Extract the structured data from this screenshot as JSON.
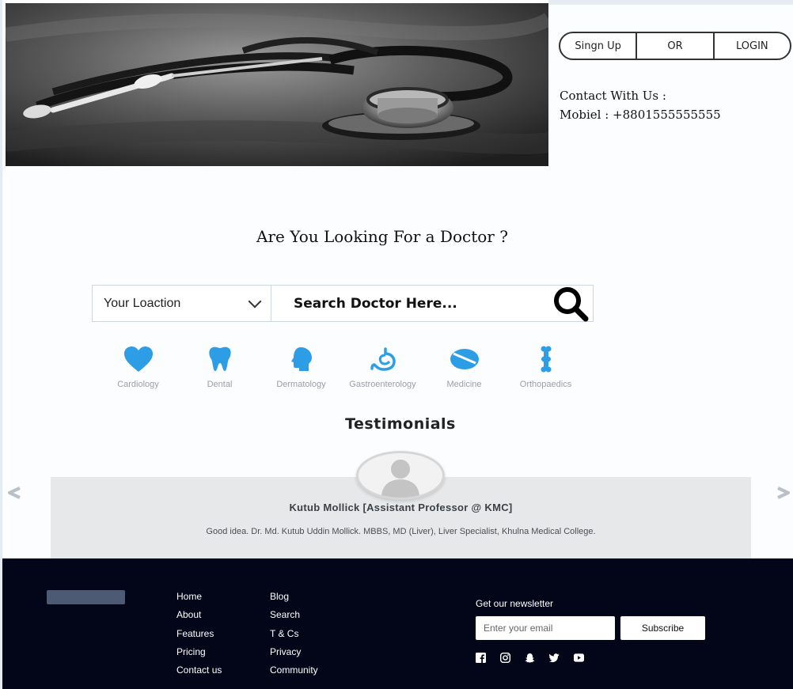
{
  "auth": {
    "signup": "Singn Up",
    "or": "OR",
    "login": "LOGIN"
  },
  "contact": {
    "heading": "Contact With Us :",
    "mobile": "Mobiel : +8801555555555"
  },
  "headline": "Are You Looking For a Doctor ?",
  "search": {
    "location_label": "Your Loaction",
    "placeholder": "Search Doctor Here..."
  },
  "categories": [
    {
      "label": "Cardiology",
      "icon": "heart-icon"
    },
    {
      "label": "Dental",
      "icon": "tooth-icon"
    },
    {
      "label": "Dermatology",
      "icon": "head-icon"
    },
    {
      "label": "Gastroenterology",
      "icon": "stomach-icon"
    },
    {
      "label": "Medicine",
      "icon": "pill-icon"
    },
    {
      "label": "Orthopaedics",
      "icon": "bone-icon"
    }
  ],
  "testimonials": {
    "title": "Testimonials",
    "name": "Kutub Mollick [Assistant Professor @ KMC]",
    "quote": "Good idea. Dr. Md. Kutub Uddin Mollick. MBBS, MD (Liver), Liver Specialist, Khulna Medical College."
  },
  "footer": {
    "col1": [
      "Home",
      "About",
      "Features",
      "Pricing",
      "Contact us"
    ],
    "col2": [
      "Blog",
      "Search",
      "T & Cs",
      "Privacy",
      "Community"
    ],
    "newsletter": {
      "title": "Get our newsletter",
      "placeholder": "Enter your email",
      "button": "Subscribe"
    },
    "social": [
      "facebook-icon",
      "instagram-icon",
      "snapchat-icon",
      "twitter-icon",
      "youtube-icon"
    ]
  },
  "colors": {
    "accent": "#2d9ee6",
    "footer_bg": "#020618",
    "testimonial_bg": "#e6e8e9"
  }
}
